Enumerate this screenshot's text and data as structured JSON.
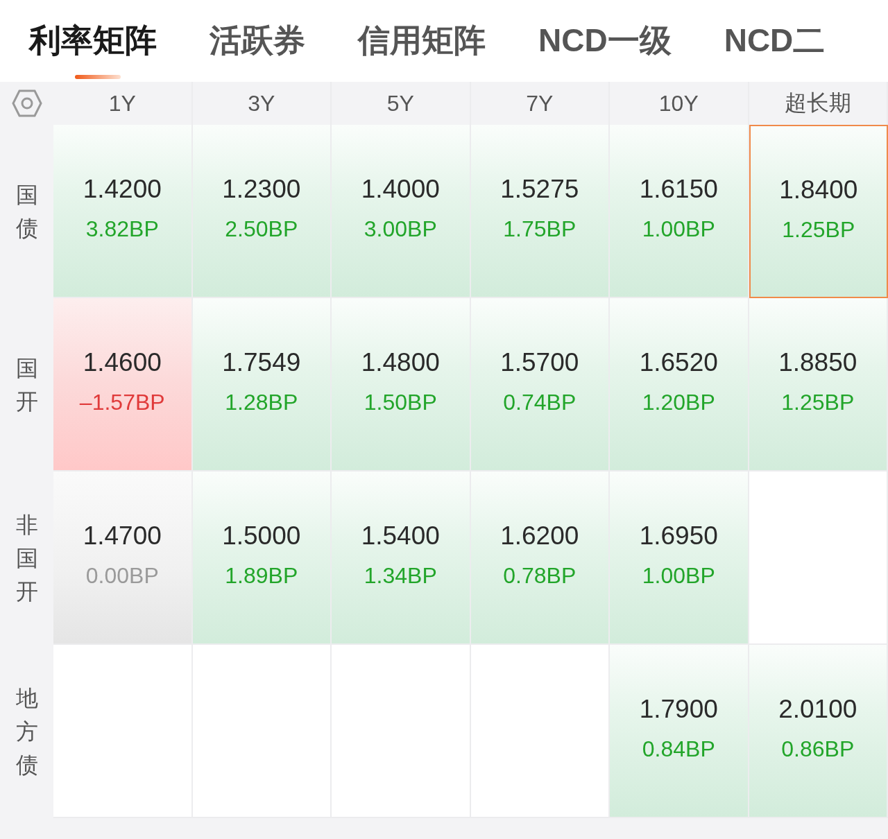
{
  "tabs": [
    {
      "label": "利率矩阵",
      "selected": true
    },
    {
      "label": "活跃券",
      "selected": false
    },
    {
      "label": "信用矩阵",
      "selected": false
    },
    {
      "label": "NCD一级",
      "selected": false
    },
    {
      "label": "NCD二",
      "selected": false
    }
  ],
  "matrix": {
    "columns": [
      "1Y",
      "3Y",
      "5Y",
      "7Y",
      "10Y",
      "超长期"
    ],
    "rows": [
      {
        "label": "国债",
        "cells": [
          {
            "kind": "up",
            "yield": "1.4200",
            "change": "3.82BP",
            "selected": false
          },
          {
            "kind": "up",
            "yield": "1.2300",
            "change": "2.50BP",
            "selected": false
          },
          {
            "kind": "up",
            "yield": "1.4000",
            "change": "3.00BP",
            "selected": false
          },
          {
            "kind": "up",
            "yield": "1.5275",
            "change": "1.75BP",
            "selected": false
          },
          {
            "kind": "up",
            "yield": "1.6150",
            "change": "1.00BP",
            "selected": false
          },
          {
            "kind": "up",
            "yield": "1.8400",
            "change": "1.25BP",
            "selected": true
          }
        ]
      },
      {
        "label": "国开",
        "cells": [
          {
            "kind": "down",
            "yield": "1.4600",
            "change": "–1.57BP",
            "selected": false
          },
          {
            "kind": "up",
            "yield": "1.7549",
            "change": "1.28BP",
            "selected": false
          },
          {
            "kind": "up",
            "yield": "1.4800",
            "change": "1.50BP",
            "selected": false
          },
          {
            "kind": "up",
            "yield": "1.5700",
            "change": "0.74BP",
            "selected": false
          },
          {
            "kind": "up",
            "yield": "1.6520",
            "change": "1.20BP",
            "selected": false
          },
          {
            "kind": "up",
            "yield": "1.8850",
            "change": "1.25BP",
            "selected": false
          }
        ]
      },
      {
        "label": "非国开",
        "cells": [
          {
            "kind": "flat",
            "yield": "1.4700",
            "change": "0.00BP",
            "selected": false
          },
          {
            "kind": "up",
            "yield": "1.5000",
            "change": "1.89BP",
            "selected": false
          },
          {
            "kind": "up",
            "yield": "1.5400",
            "change": "1.34BP",
            "selected": false
          },
          {
            "kind": "up",
            "yield": "1.6200",
            "change": "0.78BP",
            "selected": false
          },
          {
            "kind": "up",
            "yield": "1.6950",
            "change": "1.00BP",
            "selected": false
          },
          {
            "kind": "empty",
            "selected": false
          }
        ]
      },
      {
        "label": "地方债",
        "cells": [
          {
            "kind": "empty",
            "selected": false
          },
          {
            "kind": "empty",
            "selected": false
          },
          {
            "kind": "empty",
            "selected": false
          },
          {
            "kind": "empty",
            "selected": false
          },
          {
            "kind": "up",
            "yield": "1.7900",
            "change": "0.84BP",
            "selected": false
          },
          {
            "kind": "up",
            "yield": "2.0100",
            "change": "0.86BP",
            "selected": false
          }
        ]
      }
    ]
  }
}
